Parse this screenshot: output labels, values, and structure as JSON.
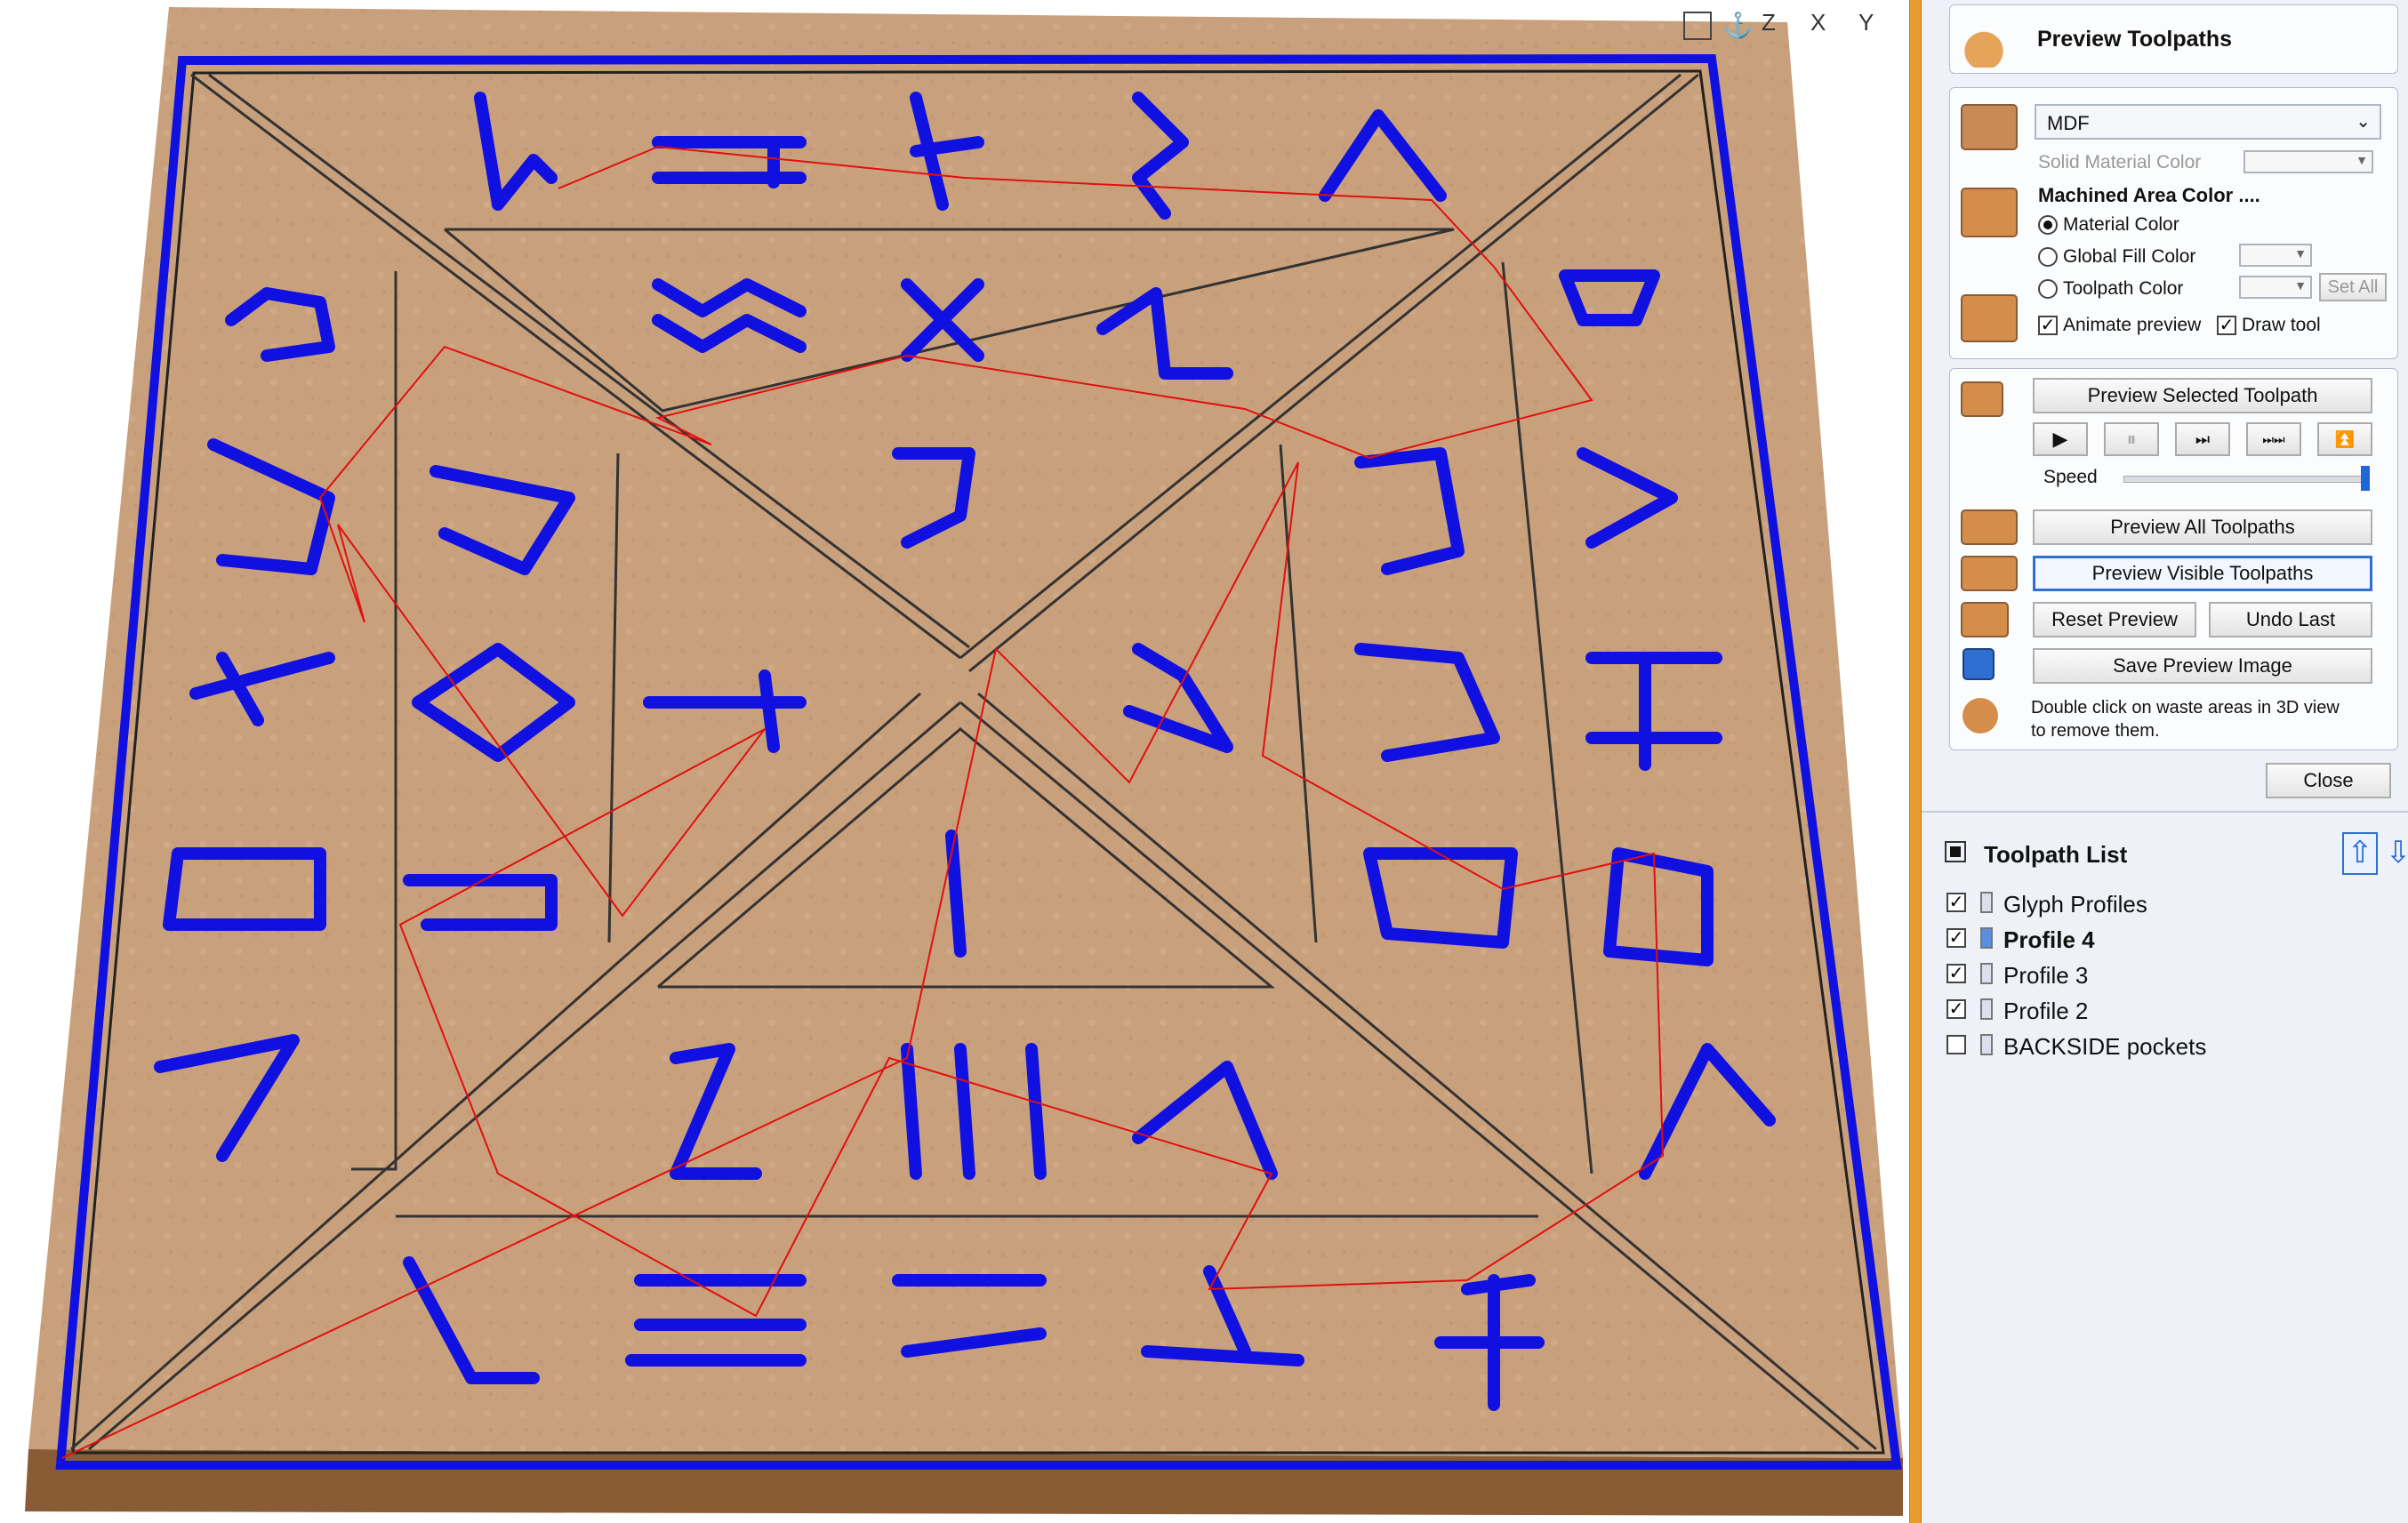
{
  "viewport": {
    "view_icons": [
      "fit-view-icon",
      "iso-view-icon",
      "view-z-icon",
      "view-x-icon",
      "view-y-icon"
    ],
    "view_labels": [
      "Z",
      "X",
      "Y"
    ]
  },
  "panel": {
    "title": "Preview Toolpaths",
    "material": {
      "selected": "MDF",
      "solid_material_color_label": "Solid Material Color",
      "machined_area_color_label": "Machined Area Color ....",
      "options": [
        "Material Color",
        "Global Fill Color",
        "Toolpath Color"
      ],
      "selected_option": "Material Color",
      "set_all_label": "Set All",
      "animate_preview_label": "Animate preview",
      "animate_preview_checked": true,
      "draw_tool_label": "Draw tool",
      "draw_tool_checked": true
    },
    "preview": {
      "preview_selected_label": "Preview Selected Toolpath",
      "playback": [
        "▶",
        "⏸",
        "⏭",
        "⏭⏭",
        "⏫"
      ],
      "speed_label": "Speed",
      "speed_level": 1.0,
      "preview_all_label": "Preview All Toolpaths",
      "preview_visible_label": "Preview Visible Toolpaths",
      "reset_label": "Reset Preview",
      "undo_label": "Undo Last",
      "save_image_label": "Save Preview Image",
      "hint_line1": "Double click on waste areas in 3D view",
      "hint_line2": "to remove them."
    },
    "close_label": "Close",
    "toolpath_list": {
      "title": "Toolpath List",
      "items": [
        {
          "name": "Glyph Profiles",
          "checked": true,
          "bold": false
        },
        {
          "name": "Profile 4",
          "checked": true,
          "bold": true
        },
        {
          "name": "Profile 3",
          "checked": true,
          "bold": false
        },
        {
          "name": "Profile 2",
          "checked": true,
          "bold": false
        },
        {
          "name": "BACKSIDE pockets",
          "checked": false,
          "bold": false
        }
      ]
    }
  },
  "colors": {
    "wood": "#c8a07a",
    "engrave": "#1010e0",
    "rapid": "#e01010",
    "accent": "#2f6fd2",
    "splitter": "#e89a2c"
  }
}
